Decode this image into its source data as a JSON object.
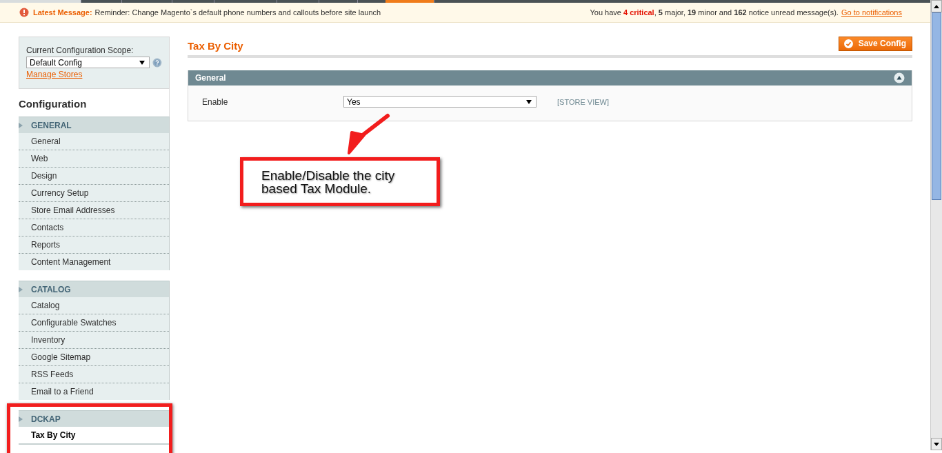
{
  "message_bar": {
    "label": "Latest Message:",
    "text": "Reminder: Change Magento`s default phone numbers and callouts before site launch",
    "notice": [
      {
        "text": "You have ",
        "kind": "plain"
      },
      {
        "text": "4 critical",
        "kind": "critical"
      },
      {
        "text": ", ",
        "kind": "plain"
      },
      {
        "text": "5",
        "kind": "bold"
      },
      {
        "text": " major, ",
        "kind": "plain"
      },
      {
        "text": "19",
        "kind": "bold"
      },
      {
        "text": " minor and ",
        "kind": "plain"
      },
      {
        "text": "162",
        "kind": "bold"
      },
      {
        "text": " notice unread message(s).",
        "kind": "plain"
      }
    ],
    "link": "Go to notifications"
  },
  "scope": {
    "label": "Current Configuration Scope:",
    "value": "Default Config",
    "link": "Manage Stores"
  },
  "sidebar": {
    "title": "Configuration",
    "groups": [
      {
        "title": "GENERAL",
        "items": [
          {
            "label": "General",
            "selected": false
          },
          {
            "label": "Web",
            "selected": false
          },
          {
            "label": "Design",
            "selected": false
          },
          {
            "label": "Currency Setup",
            "selected": false
          },
          {
            "label": "Store Email Addresses",
            "selected": false
          },
          {
            "label": "Contacts",
            "selected": false
          },
          {
            "label": "Reports",
            "selected": false
          },
          {
            "label": "Content Management",
            "selected": false
          }
        ]
      },
      {
        "title": "CATALOG",
        "items": [
          {
            "label": "Catalog",
            "selected": false
          },
          {
            "label": "Configurable Swatches",
            "selected": false
          },
          {
            "label": "Inventory",
            "selected": false
          },
          {
            "label": "Google Sitemap",
            "selected": false
          },
          {
            "label": "RSS Feeds",
            "selected": false
          },
          {
            "label": "Email to a Friend",
            "selected": false
          }
        ]
      },
      {
        "title": "DCKAP",
        "items": [
          {
            "label": "Tax By City",
            "selected": true
          }
        ]
      }
    ]
  },
  "page": {
    "title": "Tax By City",
    "save_button": "Save Config",
    "section": {
      "title": "General",
      "expanded": true,
      "fields": [
        {
          "label": "Enable",
          "value": "Yes",
          "scope": "[STORE VIEW]"
        }
      ]
    }
  },
  "annotation": {
    "text": "Enable/Disable the city based Tax Module."
  }
}
